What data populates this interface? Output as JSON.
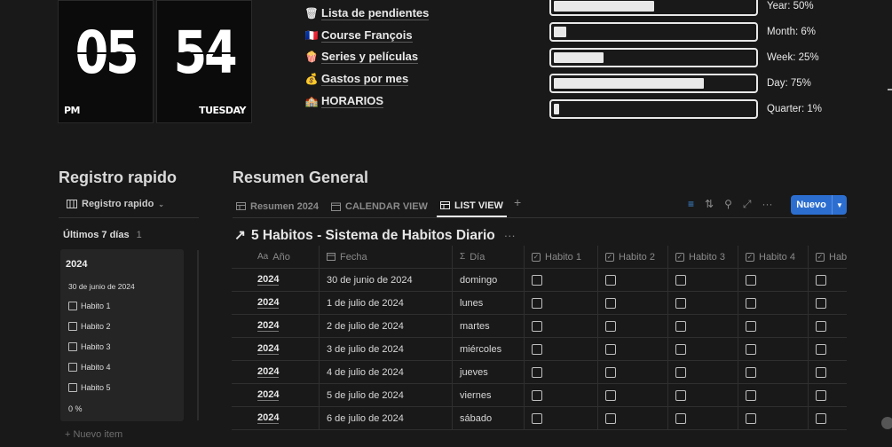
{
  "clock": {
    "hour": "05",
    "minute": "54",
    "ampm": "PM",
    "day": "TUESDAY"
  },
  "links": [
    {
      "icon": "trash-icon",
      "glyph": "🗑",
      "label": "Lista de pendientes"
    },
    {
      "icon": "france-flag-icon",
      "glyph": "🇫🇷",
      "label": "Course François"
    },
    {
      "icon": "popcorn-icon",
      "glyph": "🍿",
      "label": "Series y películas"
    },
    {
      "icon": "money-bag-icon",
      "glyph": "💰",
      "label": "Gastos por mes"
    },
    {
      "icon": "building-icon",
      "glyph": "🏫",
      "label": "HORARIOS"
    }
  ],
  "progress": [
    {
      "label": "Year: 50%",
      "value": 0.5
    },
    {
      "label": "Month: 6%",
      "value": 0.06
    },
    {
      "label": "Week: 25%",
      "value": 0.25
    },
    {
      "label": "Day: 75%",
      "value": 0.75
    },
    {
      "label": "Quarter: 1%",
      "value": 0.01
    }
  ],
  "left": {
    "title": "Registro rapido",
    "view_label": "Registro rapido",
    "group_label": "Últimos 7 días",
    "group_count": "1",
    "card": {
      "year": "2024",
      "date": "30 de junio de 2024",
      "habits": [
        "Habito 1",
        "Habito 2",
        "Habito 3",
        "Habito 4",
        "Habito 5"
      ],
      "percent": "0 %"
    },
    "new_item": "+ Nuevo item"
  },
  "main": {
    "title": "Resumen General",
    "tabs": [
      {
        "label": "Resumen 2024",
        "icon": "table-icon",
        "active": false
      },
      {
        "label": "CALENDAR VIEW",
        "icon": "calendar-icon",
        "active": false
      },
      {
        "label": "LIST VIEW",
        "icon": "table-icon",
        "active": true
      }
    ],
    "new_button": "Nuevo",
    "db_title": "5 Habitos - Sistema de Habitos Diario",
    "columns": [
      "Año",
      "Fecha",
      "Día",
      "Habito 1",
      "Habito 2",
      "Habito 3",
      "Habito 4",
      "Hab"
    ],
    "column_icons": [
      "Aa",
      "calendar-icon",
      "Σ",
      "checkbox-icon",
      "checkbox-icon",
      "checkbox-icon",
      "checkbox-icon",
      "checkbox-icon"
    ],
    "rows": [
      {
        "year": "2024",
        "date": "30 de junio de 2024",
        "day": "domingo"
      },
      {
        "year": "2024",
        "date": "1 de julio de 2024",
        "day": "lunes"
      },
      {
        "year": "2024",
        "date": "2 de julio de 2024",
        "day": "martes"
      },
      {
        "year": "2024",
        "date": "3 de julio de 2024",
        "day": "miércoles"
      },
      {
        "year": "2024",
        "date": "4 de julio de 2024",
        "day": "jueves"
      },
      {
        "year": "2024",
        "date": "5 de julio de 2024",
        "day": "viernes"
      },
      {
        "year": "2024",
        "date": "6 de julio de 2024",
        "day": "sábado"
      }
    ]
  },
  "colors": {
    "background": "#191919",
    "accent": "#2c6ed0",
    "filter_icon": "#3f8fe0"
  }
}
